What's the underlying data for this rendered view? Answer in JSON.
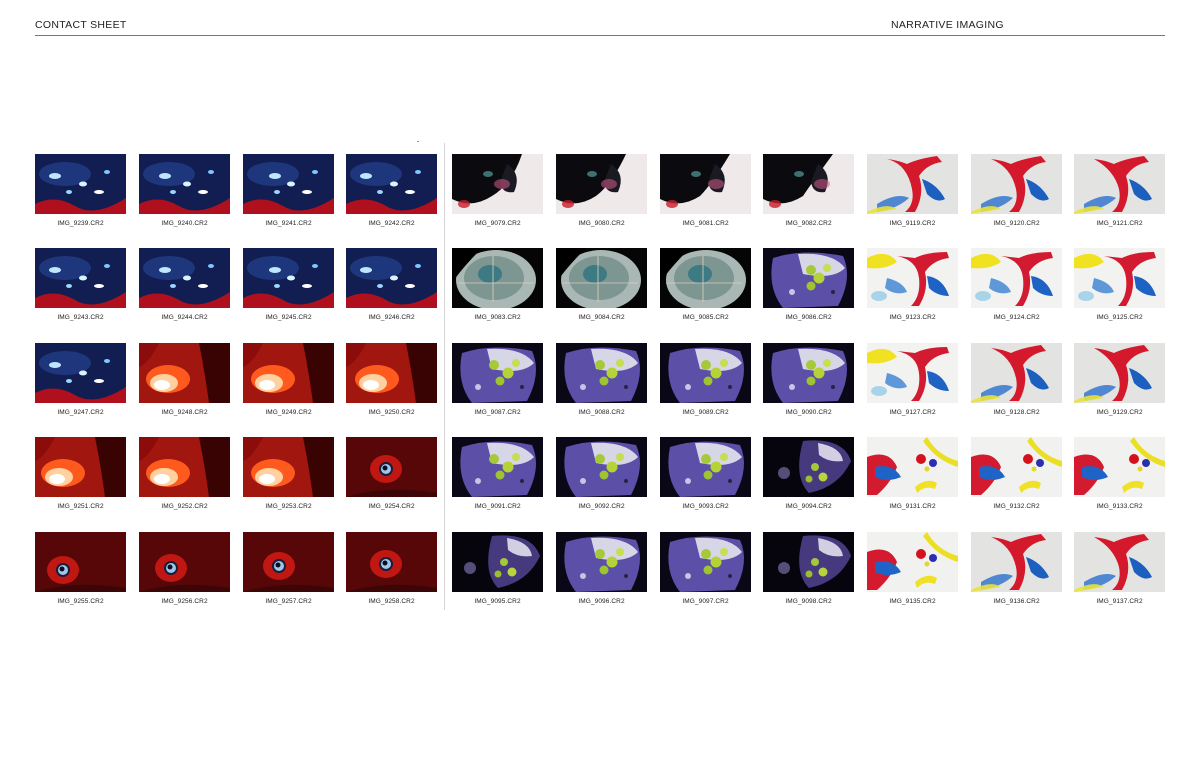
{
  "header": {
    "left_title": "CONTACT SHEET",
    "right_title": "NARRATIVE IMAGING"
  },
  "frames": [
    {
      "label": "IMG_9239.CR2",
      "style": "blue"
    },
    {
      "label": "IMG_9240.CR2",
      "style": "blue"
    },
    {
      "label": "IMG_9241.CR2",
      "style": "blue"
    },
    {
      "label": "IMG_9242.CR2",
      "style": "blue"
    },
    {
      "label": "IMG_9079.CR2",
      "style": "inkwhite"
    },
    {
      "label": "IMG_9080.CR2",
      "style": "inkwhite"
    },
    {
      "label": "IMG_9081.CR2",
      "style": "inkwhite"
    },
    {
      "label": "IMG_9082.CR2",
      "style": "inkwhite"
    },
    {
      "label": "IMG_9119.CR2",
      "style": "whitered"
    },
    {
      "label": "IMG_9120.CR2",
      "style": "whitered"
    },
    {
      "label": "IMG_9121.CR2",
      "style": "whitered"
    },
    {
      "label": "IMG_9243.CR2",
      "style": "blue"
    },
    {
      "label": "IMG_9244.CR2",
      "style": "blue"
    },
    {
      "label": "IMG_9245.CR2",
      "style": "blue"
    },
    {
      "label": "IMG_9246.CR2",
      "style": "blue"
    },
    {
      "label": "IMG_9083.CR2",
      "style": "plate"
    },
    {
      "label": "IMG_9084.CR2",
      "style": "plate"
    },
    {
      "label": "IMG_9085.CR2",
      "style": "plate"
    },
    {
      "label": "IMG_9086.CR2",
      "style": "purple"
    },
    {
      "label": "IMG_9123.CR2",
      "style": "whiteyellow"
    },
    {
      "label": "IMG_9124.CR2",
      "style": "whiteyellow"
    },
    {
      "label": "IMG_9125.CR2",
      "style": "whiteyellow"
    },
    {
      "label": "IMG_9247.CR2",
      "style": "blue"
    },
    {
      "label": "IMG_9248.CR2",
      "style": "redfire"
    },
    {
      "label": "IMG_9249.CR2",
      "style": "redfire"
    },
    {
      "label": "IMG_9250.CR2",
      "style": "redfire"
    },
    {
      "label": "IMG_9087.CR2",
      "style": "purple"
    },
    {
      "label": "IMG_9088.CR2",
      "style": "purple"
    },
    {
      "label": "IMG_9089.CR2",
      "style": "purple"
    },
    {
      "label": "IMG_9090.CR2",
      "style": "purple"
    },
    {
      "label": "IMG_9127.CR2",
      "style": "whiteyellow"
    },
    {
      "label": "IMG_9128.CR2",
      "style": "whitered"
    },
    {
      "label": "IMG_9129.CR2",
      "style": "whitered"
    },
    {
      "label": "IMG_9251.CR2",
      "style": "redfire"
    },
    {
      "label": "IMG_9252.CR2",
      "style": "redfire"
    },
    {
      "label": "IMG_9253.CR2",
      "style": "redfire"
    },
    {
      "label": "IMG_9254.CR2",
      "style": "redeye"
    },
    {
      "label": "IMG_9091.CR2",
      "style": "purple"
    },
    {
      "label": "IMG_9092.CR2",
      "style": "purple"
    },
    {
      "label": "IMG_9093.CR2",
      "style": "purple"
    },
    {
      "label": "IMG_9094.CR2",
      "style": "purpledark"
    },
    {
      "label": "IMG_9131.CR2",
      "style": "whitedots"
    },
    {
      "label": "IMG_9132.CR2",
      "style": "whitedots"
    },
    {
      "label": "IMG_9133.CR2",
      "style": "whitedots"
    },
    {
      "label": "IMG_9255.CR2",
      "style": "redeye"
    },
    {
      "label": "IMG_9256.CR2",
      "style": "redeye"
    },
    {
      "label": "IMG_9257.CR2",
      "style": "redeye"
    },
    {
      "label": "IMG_9258.CR2",
      "style": "redeye"
    },
    {
      "label": "IMG_9095.CR2",
      "style": "purpledark"
    },
    {
      "label": "IMG_9096.CR2",
      "style": "purple"
    },
    {
      "label": "IMG_9097.CR2",
      "style": "purple"
    },
    {
      "label": "IMG_9098.CR2",
      "style": "purpledark"
    },
    {
      "label": "IMG_9135.CR2",
      "style": "whitedots"
    },
    {
      "label": "IMG_9136.CR2",
      "style": "whitered"
    },
    {
      "label": "IMG_9137.CR2",
      "style": "whitered"
    }
  ]
}
